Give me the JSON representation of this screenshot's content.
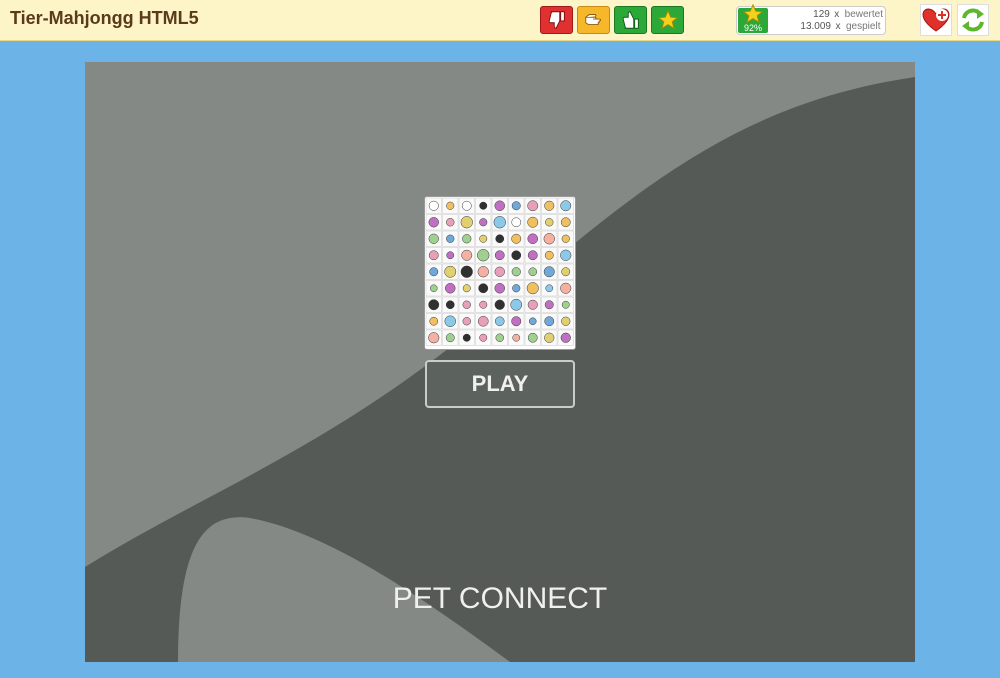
{
  "page": {
    "title": "Tier-Mahjongg HTML5"
  },
  "toolbar": {
    "buttons": [
      {
        "name": "thumbs-down",
        "color": "#e03030"
      },
      {
        "name": "hand-flat",
        "color": "#f6b82a"
      },
      {
        "name": "thumbs-up",
        "color": "#2ca838"
      },
      {
        "name": "star",
        "color": "#2ca838"
      }
    ]
  },
  "stats": {
    "rating_percent": "92%",
    "rated_count": "129",
    "rated_x": "x",
    "rated_label": "bewertet",
    "played_count": "13.009",
    "played_x": "x",
    "played_label": "gespielt"
  },
  "actions": {
    "favorite_icon": "heart-plus-icon",
    "reload_icon": "reload-icon"
  },
  "game": {
    "play_label": "PLAY",
    "name": "PET CONNECT",
    "background": "#555a56",
    "curve_color": "#848985"
  }
}
